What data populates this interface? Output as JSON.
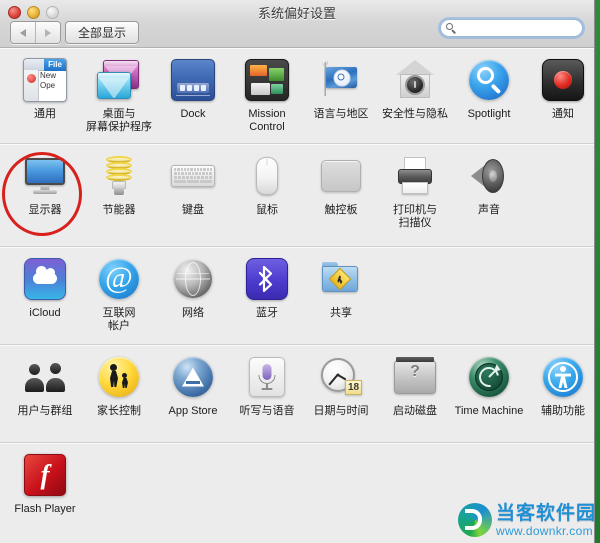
{
  "window": {
    "title": "系统偏好设置",
    "traffic_lights": {
      "close": "close-button",
      "minimize": "minimize-button",
      "zoom": "zoom-button"
    }
  },
  "toolbar": {
    "back_label": "◀",
    "forward_label": "▶",
    "show_all_label": "全部显示",
    "search": {
      "value": "",
      "placeholder": ""
    }
  },
  "rows": [
    {
      "id": "personal",
      "items": [
        {
          "label": "通用",
          "icon": "general-icon",
          "icon_text": "File"
        },
        {
          "label": "桌面与",
          "label2": "屏幕保护程序",
          "icon": "desktop-screensaver-icon"
        },
        {
          "label": "Dock",
          "icon": "dock-icon"
        },
        {
          "label": "Mission",
          "label2": "Control",
          "icon": "mission-control-icon"
        },
        {
          "label": "语言与地区",
          "icon": "language-region-icon"
        },
        {
          "label": "安全性与隐私",
          "icon": "security-privacy-icon"
        },
        {
          "label": "Spotlight",
          "icon": "spotlight-icon"
        },
        {
          "label": "通知",
          "icon": "notifications-icon"
        }
      ]
    },
    {
      "id": "hardware",
      "items": [
        {
          "label": "显示器",
          "icon": "displays-icon",
          "highlighted": true
        },
        {
          "label": "节能器",
          "icon": "energy-saver-icon"
        },
        {
          "label": "键盘",
          "icon": "keyboard-icon"
        },
        {
          "label": "鼠标",
          "icon": "mouse-icon"
        },
        {
          "label": "触控板",
          "icon": "trackpad-icon"
        },
        {
          "label": "打印机与",
          "label2": "扫描仪",
          "icon": "printers-scanners-icon"
        },
        {
          "label": "声音",
          "icon": "sound-icon"
        }
      ]
    },
    {
      "id": "internet",
      "items": [
        {
          "label": "iCloud",
          "icon": "icloud-icon"
        },
        {
          "label": "互联网",
          "label2": "帐户",
          "icon": "internet-accounts-icon"
        },
        {
          "label": "网络",
          "icon": "network-icon"
        },
        {
          "label": "蓝牙",
          "icon": "bluetooth-icon"
        },
        {
          "label": "共享",
          "icon": "sharing-icon"
        }
      ]
    },
    {
      "id": "system",
      "items": [
        {
          "label": "用户与群组",
          "icon": "users-groups-icon"
        },
        {
          "label": "家长控制",
          "icon": "parental-controls-icon"
        },
        {
          "label": "App Store",
          "icon": "app-store-icon"
        },
        {
          "label": "听写与语音",
          "icon": "dictation-speech-icon"
        },
        {
          "label": "日期与时间",
          "icon": "date-time-icon",
          "icon_text": "18"
        },
        {
          "label": "启动磁盘",
          "icon": "startup-disk-icon",
          "icon_text": "?"
        },
        {
          "label": "Time Machine",
          "icon": "time-machine-icon"
        },
        {
          "label": "辅助功能",
          "icon": "accessibility-icon"
        }
      ]
    },
    {
      "id": "other",
      "items": [
        {
          "label": "Flash Player",
          "icon": "flash-player-icon",
          "icon_text": "f"
        }
      ]
    }
  ],
  "annotation": {
    "type": "circle-highlight",
    "target": "显示器",
    "color": "#d8211d"
  },
  "watermark": {
    "name": "当客软件园",
    "url": "www.downkr.com"
  },
  "colors": {
    "window_background": "#ececec",
    "titlebar": "#d6d6d6",
    "separator": "#d0d0d0",
    "annotation_red": "#d8211d",
    "watermark_blue": "#1f8fd6",
    "desktop_green": "#1f7a2e"
  }
}
